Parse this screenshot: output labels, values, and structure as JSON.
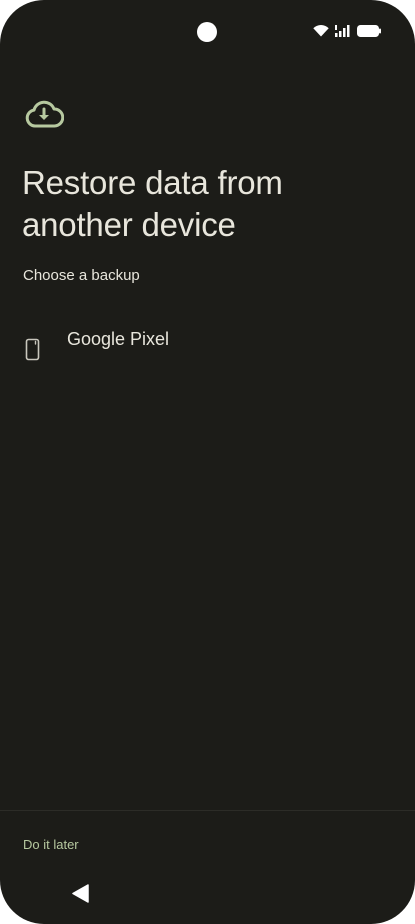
{
  "status_bar": {
    "icons": [
      "wifi-icon",
      "signal-icon",
      "battery-icon"
    ]
  },
  "main": {
    "hero_icon": "cloud-download-icon",
    "title": "Restore data from another device",
    "subtitle": "Choose a backup",
    "backups": [
      {
        "icon": "phone-icon",
        "name": "Google Pixel"
      }
    ]
  },
  "footer": {
    "later_label": "Do it later"
  },
  "nav": {
    "back_icon": "back-triangle-icon"
  },
  "colors": {
    "background": "#1c1c18",
    "text": "#e8e6dc",
    "accent": "#b7c9a0"
  }
}
